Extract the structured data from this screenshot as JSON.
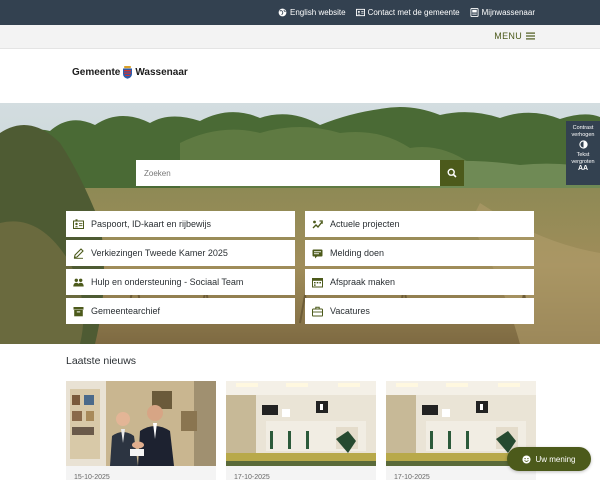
{
  "colors": {
    "top_bar": "#334150",
    "accent": "#4c5a1b",
    "menu_bar": "#f3f3f3"
  },
  "topbar": {
    "links": [
      {
        "label": "English website",
        "icon": "globe-icon"
      },
      {
        "label": "Contact met de gemeente",
        "icon": "contact-icon"
      },
      {
        "label": "Mijnwassenaar",
        "icon": "account-icon"
      }
    ]
  },
  "menu": {
    "label": "MENU",
    "icon": "hamburger-icon"
  },
  "logo": {
    "text_left": "Gemeente",
    "text_right": "Wassenaar",
    "icon": "coat-of-arms-icon"
  },
  "search": {
    "placeholder": "Zoeken",
    "icon": "search-icon"
  },
  "tiles": [
    {
      "label": "Paspoort, ID-kaart en rijbewijs",
      "icon": "id-card-icon"
    },
    {
      "label": "Actuele projecten",
      "icon": "projects-icon"
    },
    {
      "label": "Verkiezingen Tweede Kamer 2025",
      "icon": "pencil-icon"
    },
    {
      "label": "Melding doen",
      "icon": "report-icon"
    },
    {
      "label": "Hulp en ondersteuning - Sociaal Team",
      "icon": "people-icon"
    },
    {
      "label": "Afspraak maken",
      "icon": "appointment-icon"
    },
    {
      "label": "Gemeentearchief",
      "icon": "archive-icon"
    },
    {
      "label": "Vacatures",
      "icon": "briefcase-icon"
    }
  ],
  "accessibility": {
    "contrast_label_1": "Contrast",
    "contrast_label_2": "verhogen",
    "text_label_1": "Tekst",
    "text_label_2": "vergroten",
    "text_icon_label": "AA"
  },
  "news": {
    "title": "Laatste nieuws",
    "items": [
      {
        "date": "15-10-2025",
        "image": "two-men-handshake"
      },
      {
        "date": "17-10-2025",
        "image": "office-room"
      },
      {
        "date": "17-10-2025",
        "image": "office-room"
      }
    ]
  },
  "feedback": {
    "label": "Uw mening",
    "icon": "smiley-icon"
  }
}
